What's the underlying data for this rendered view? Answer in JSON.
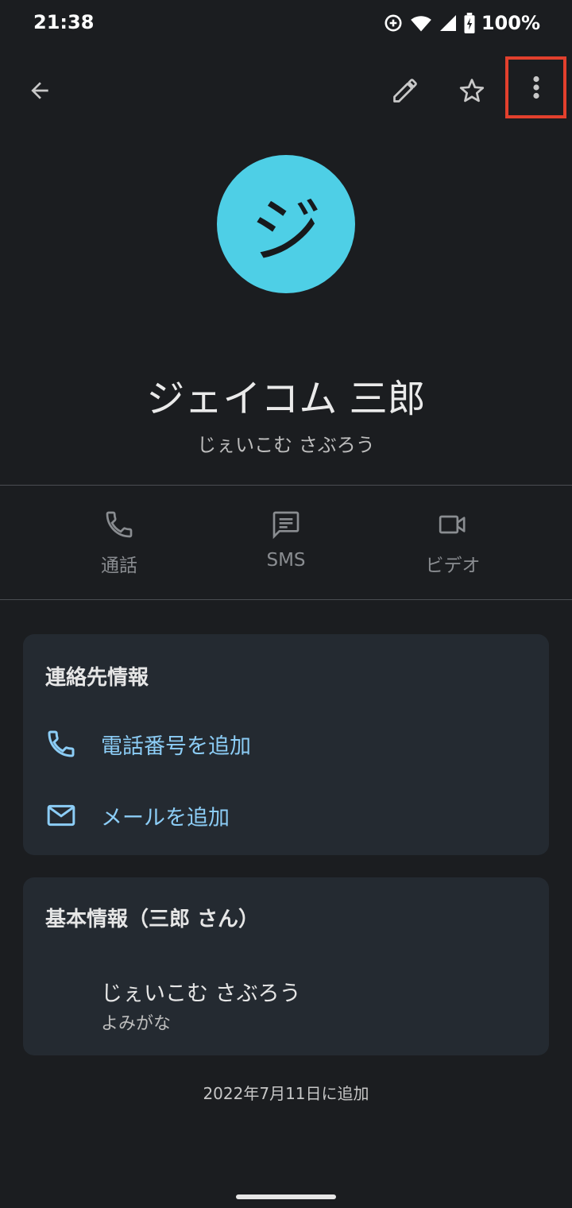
{
  "status_bar": {
    "time": "21:38",
    "battery": "100%",
    "icons": [
      "data-saver-icon",
      "wifi-icon",
      "signal-icon",
      "battery-charging-icon"
    ]
  },
  "toolbar": {
    "icons": [
      "back-arrow-icon",
      "edit-pencil-icon",
      "star-outline-icon",
      "more-vert-icon"
    ]
  },
  "contact": {
    "avatar_initial": "ジ",
    "avatar_color": "#4ecfe6",
    "name": "ジェイコム 三郎",
    "reading": "じぇいこむ さぶろう"
  },
  "actions": [
    {
      "label": "通話",
      "icon": "phone-icon"
    },
    {
      "label": "SMS",
      "icon": "message-icon"
    },
    {
      "label": "ビデオ",
      "icon": "videocam-icon"
    }
  ],
  "contact_info": {
    "title": "連絡先情報",
    "add_phone": "電話番号を追加",
    "add_email": "メールを追加"
  },
  "basic_info": {
    "title": "基本情報（三郎 さん）",
    "reading_value": "じぇいこむ さぶろう",
    "reading_caption": "よみがな"
  },
  "added_date": "2022年7月11日に追加",
  "colors": {
    "background": "#1b1d20",
    "card": "#242a31",
    "link": "#8ccdf6",
    "highlight": "#e2402d"
  }
}
